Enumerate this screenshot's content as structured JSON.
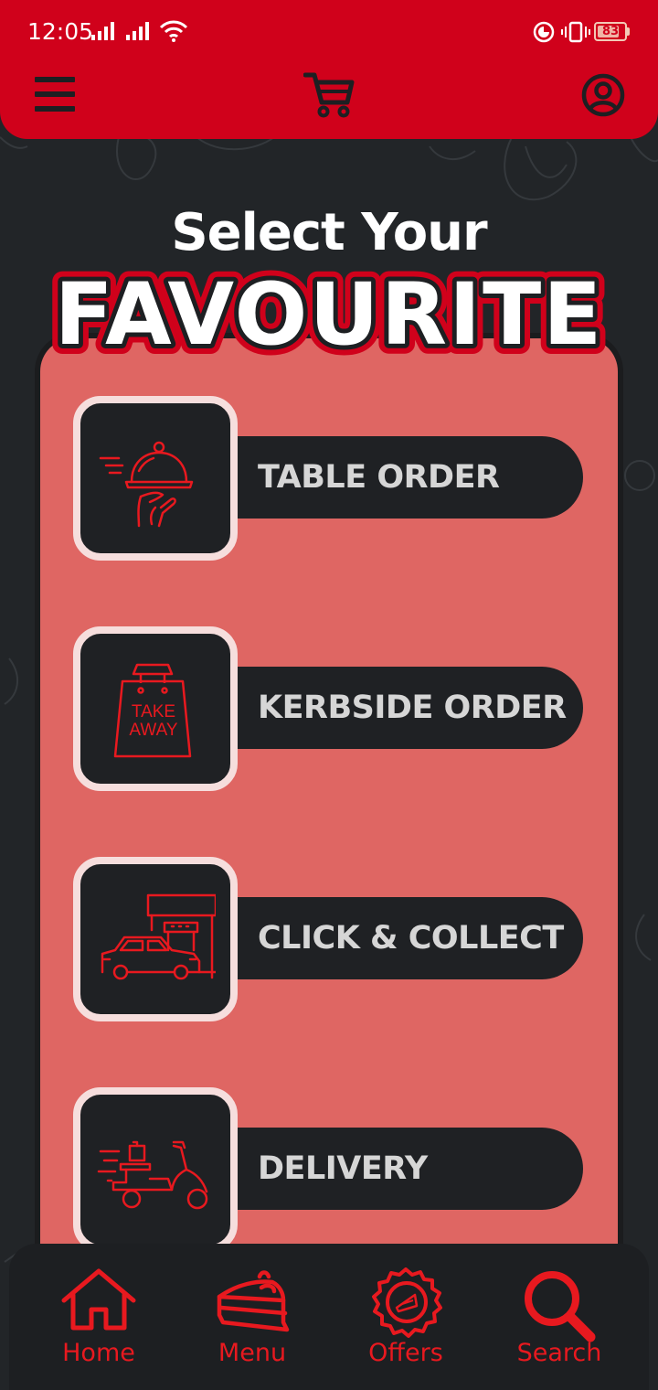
{
  "status_bar": {
    "time": "12:05",
    "battery": "83",
    "battery_level": 0.83
  },
  "header": {
    "menu_icon": "hamburger-menu-icon",
    "cart_icon": "shopping-cart-icon",
    "profile_icon": "user-profile-icon"
  },
  "title": {
    "line1": "Select Your",
    "line2": "FAVOURITE"
  },
  "options": [
    {
      "label": "TABLE ORDER",
      "icon": "serving-cloche-icon"
    },
    {
      "label": "KERBSIDE ORDER",
      "icon": "take-away-bag-icon",
      "icon_text_1": "TAKE",
      "icon_text_2": "AWAY"
    },
    {
      "label": "CLICK & COLLECT",
      "icon": "car-store-icon"
    },
    {
      "label": "DELIVERY",
      "icon": "delivery-scooter-icon"
    }
  ],
  "bottom_nav": [
    {
      "label": "Home",
      "icon": "home-icon"
    },
    {
      "label": "Menu",
      "icon": "cake-slice-icon"
    },
    {
      "label": "Offers",
      "icon": "offers-badge-icon"
    },
    {
      "label": "Search",
      "icon": "search-icon"
    }
  ],
  "colors": {
    "header": "#d0011b",
    "background": "#222528",
    "panel": "#df6663",
    "accent": "#e8191f"
  }
}
